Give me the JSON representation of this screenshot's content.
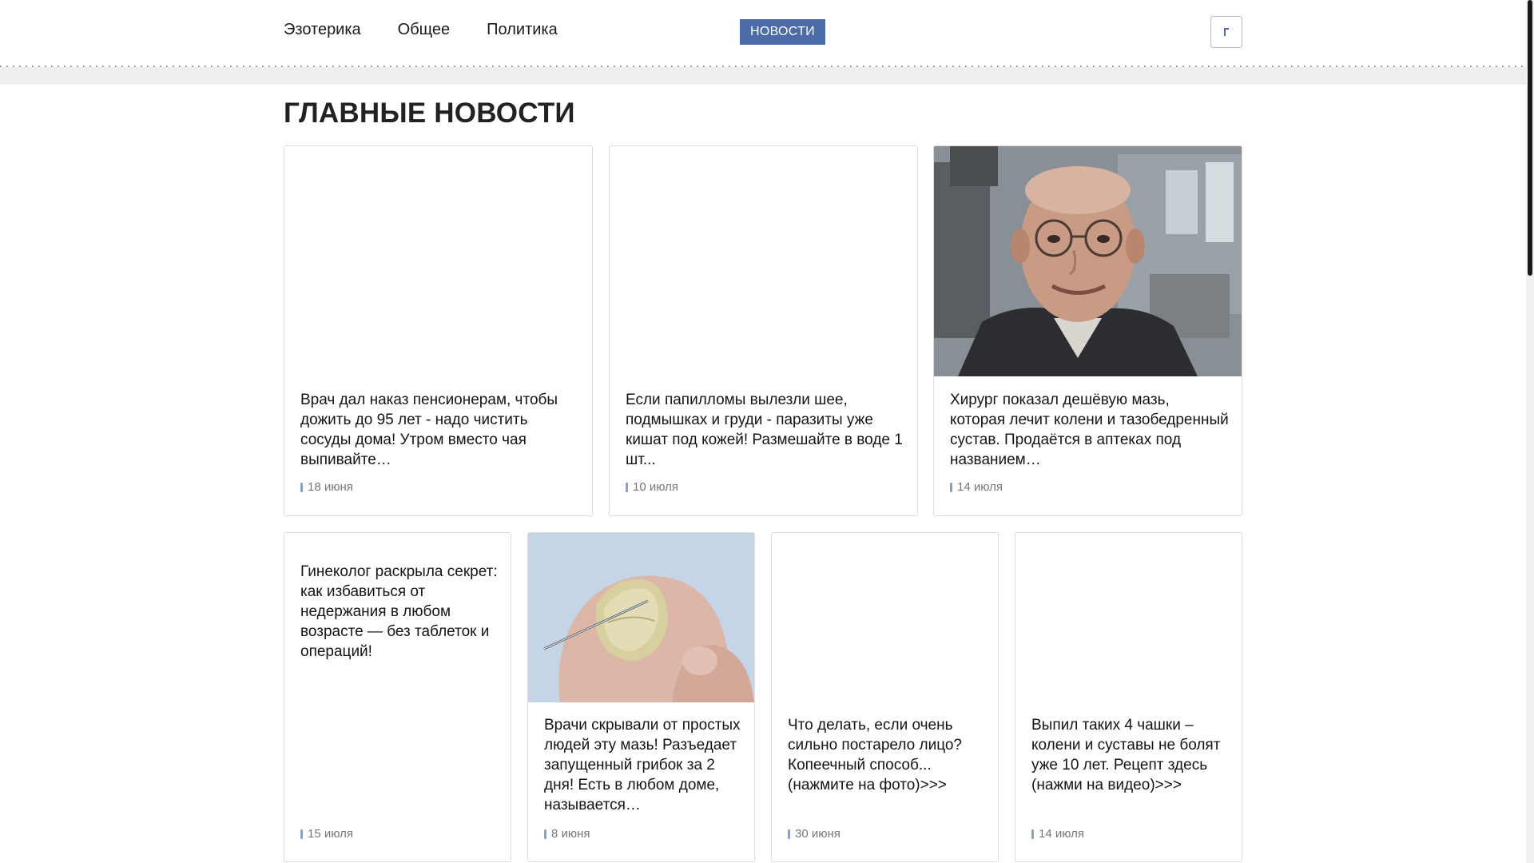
{
  "header": {
    "nav": [
      {
        "label": "Эзотерика"
      },
      {
        "label": "Общее"
      },
      {
        "label": "Политика"
      }
    ],
    "badge": "НОВОСТИ",
    "search_icon": "search-icon"
  },
  "main": {
    "title": "ГЛАВНЫЕ НОВОСТИ",
    "cards": [
      {
        "title": "Врач дал наказ пенсионерам, чтобы дожить до 95 лет - надо чистить сосуды дома! Утром вместо чая выпивайте…",
        "date": "18 июня"
      },
      {
        "title": "Если папилломы вылезли шее, подмышках и груди - паразиты уже кишат под кожей! Размешайте в воде 1 шт...",
        "date": "10 июля"
      },
      {
        "title": "Хирург показал дешёвую мазь, которая лечит колени и тазобедренный сустав. Продаётся в аптеках под названием…",
        "date": "14 июля"
      },
      {
        "title": "Гинеколог раскрыла секрет: как избавиться от недержания в любом возрасте — без таблеток и операций!",
        "date": "15 июля"
      },
      {
        "title": "Врачи скрывали от простых людей эту мазь! Разъедает запущенный грибок за 2 дня! Есть в любом доме, называется…",
        "date": "8 июня"
      },
      {
        "title": "Что делать, если очень сильно постарело лицо? Копеечный способ... (нажмите на фото)>>>",
        "date": "30 июня"
      },
      {
        "title": "Выпил таких 4 чашки – колени и суставы не болят уже 10 лет. Рецепт здесь (нажми на видео)>>>",
        "date": "14 июля"
      }
    ]
  },
  "colors": {
    "accent": "#4b6ca6",
    "text": "#141414",
    "date": "#777777"
  }
}
